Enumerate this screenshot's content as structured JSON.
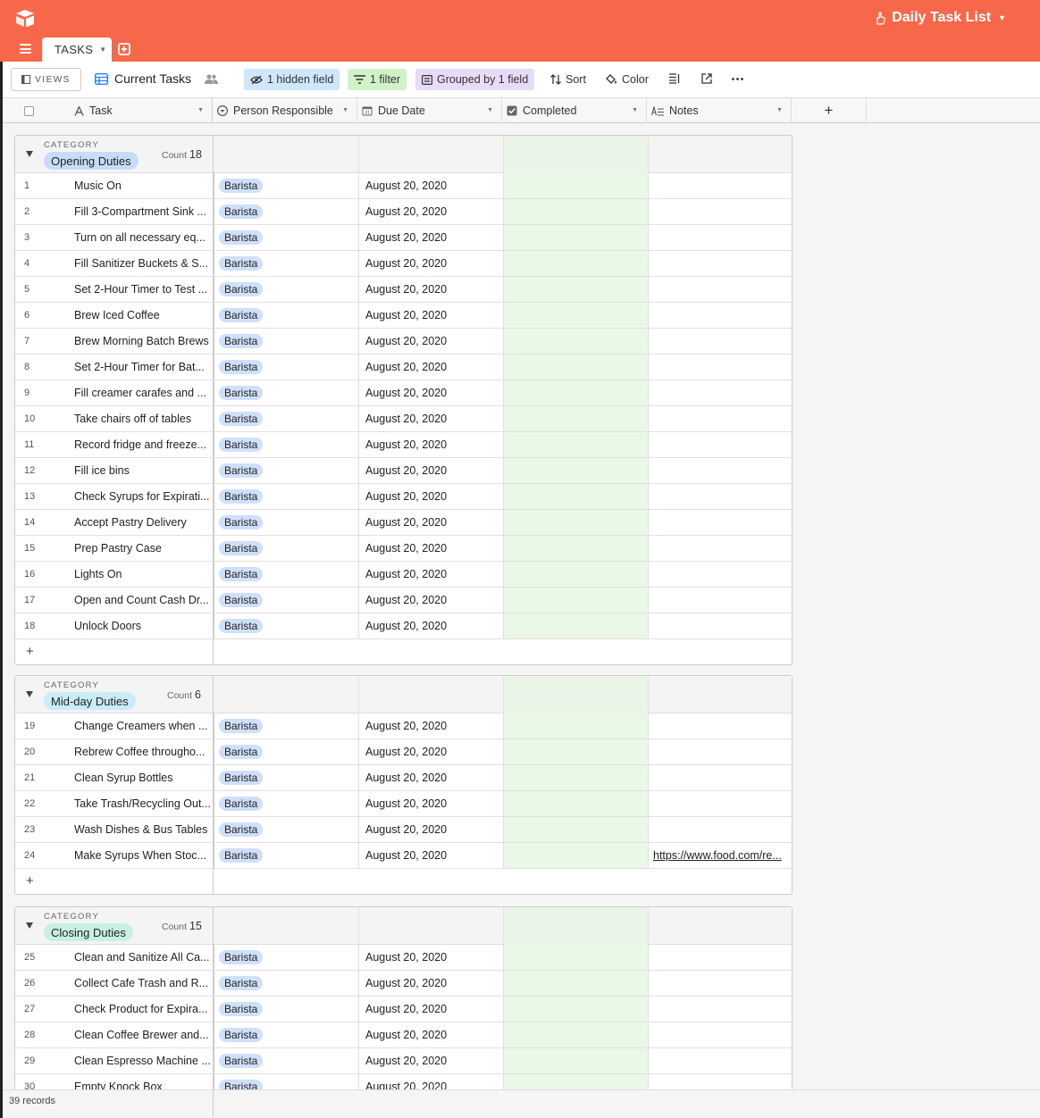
{
  "app": {
    "base_title": "Daily Task List",
    "tab_label": "TASKS",
    "colors": {
      "header": "#f7684a",
      "completed_col": "#eaf8e7"
    }
  },
  "toolbar": {
    "views_label": "VIEWS",
    "view_name": "Current Tasks",
    "hidden_field": "1 hidden field",
    "filter": "1 filter",
    "grouped": "Grouped by 1 field",
    "sort": "Sort",
    "color": "Color"
  },
  "columns": {
    "task": "Task",
    "person": "Person Responsible",
    "due": "Due Date",
    "completed": "Completed",
    "notes": "Notes"
  },
  "group_label": "CATEGORY",
  "count_label": "Count",
  "groups": [
    {
      "name": "Opening Duties",
      "count": "18",
      "chip_color": "#c6dcf9",
      "rows": [
        {
          "num": "1",
          "task": "Music On",
          "person": "Barista",
          "date": "August 20, 2020",
          "notes": ""
        },
        {
          "num": "2",
          "task": "Fill 3-Compartment Sink ...",
          "person": "Barista",
          "date": "August 20, 2020",
          "notes": ""
        },
        {
          "num": "3",
          "task": "Turn on all necessary eq...",
          "person": "Barista",
          "date": "August 20, 2020",
          "notes": ""
        },
        {
          "num": "4",
          "task": "Fill Sanitizer Buckets & S...",
          "person": "Barista",
          "date": "August 20, 2020",
          "notes": ""
        },
        {
          "num": "5",
          "task": "Set 2-Hour Timer to Test ...",
          "person": "Barista",
          "date": "August 20, 2020",
          "notes": ""
        },
        {
          "num": "6",
          "task": "Brew Iced Coffee",
          "person": "Barista",
          "date": "August 20, 2020",
          "notes": ""
        },
        {
          "num": "7",
          "task": "Brew Morning Batch Brews",
          "person": "Barista",
          "date": "August 20, 2020",
          "notes": ""
        },
        {
          "num": "8",
          "task": "Set 2-Hour Timer for Bat...",
          "person": "Barista",
          "date": "August 20, 2020",
          "notes": ""
        },
        {
          "num": "9",
          "task": "Fill creamer carafes and ...",
          "person": "Barista",
          "date": "August 20, 2020",
          "notes": ""
        },
        {
          "num": "10",
          "task": "Take chairs off of tables",
          "person": "Barista",
          "date": "August 20, 2020",
          "notes": ""
        },
        {
          "num": "11",
          "task": "Record fridge and freeze...",
          "person": "Barista",
          "date": "August 20, 2020",
          "notes": ""
        },
        {
          "num": "12",
          "task": "Fill ice bins",
          "person": "Barista",
          "date": "August 20, 2020",
          "notes": ""
        },
        {
          "num": "13",
          "task": "Check Syrups for Expirati...",
          "person": "Barista",
          "date": "August 20, 2020",
          "notes": ""
        },
        {
          "num": "14",
          "task": "Accept Pastry Delivery",
          "person": "Barista",
          "date": "August 20, 2020",
          "notes": ""
        },
        {
          "num": "15",
          "task": "Prep Pastry Case",
          "person": "Barista",
          "date": "August 20, 2020",
          "notes": ""
        },
        {
          "num": "16",
          "task": "Lights On",
          "person": "Barista",
          "date": "August 20, 2020",
          "notes": ""
        },
        {
          "num": "17",
          "task": "Open and Count Cash Dr...",
          "person": "Barista",
          "date": "August 20, 2020",
          "notes": ""
        },
        {
          "num": "18",
          "task": "Unlock Doors",
          "person": "Barista",
          "date": "August 20, 2020",
          "notes": ""
        }
      ]
    },
    {
      "name": "Mid-day Duties",
      "count": "6",
      "chip_color": "#c9ecf7",
      "rows": [
        {
          "num": "19",
          "task": "Change Creamers when ...",
          "person": "Barista",
          "date": "August 20, 2020",
          "notes": ""
        },
        {
          "num": "20",
          "task": "Rebrew Coffee througho...",
          "person": "Barista",
          "date": "August 20, 2020",
          "notes": ""
        },
        {
          "num": "21",
          "task": "Clean Syrup Bottles",
          "person": "Barista",
          "date": "August 20, 2020",
          "notes": ""
        },
        {
          "num": "22",
          "task": "Take Trash/Recycling Out...",
          "person": "Barista",
          "date": "August 20, 2020",
          "notes": ""
        },
        {
          "num": "23",
          "task": "Wash Dishes & Bus Tables",
          "person": "Barista",
          "date": "August 20, 2020",
          "notes": ""
        },
        {
          "num": "24",
          "task": "Make Syrups When Stoc...",
          "person": "Barista",
          "date": "August 20, 2020",
          "notes": "https://www.food.com/re..."
        }
      ]
    },
    {
      "name": "Closing Duties",
      "count": "15",
      "chip_color": "#c8f1e2",
      "rows": [
        {
          "num": "25",
          "task": "Clean and Sanitize All Ca...",
          "person": "Barista",
          "date": "August 20, 2020",
          "notes": ""
        },
        {
          "num": "26",
          "task": "Collect Cafe Trash and R...",
          "person": "Barista",
          "date": "August 20, 2020",
          "notes": ""
        },
        {
          "num": "27",
          "task": "Check Product for Expira...",
          "person": "Barista",
          "date": "August 20, 2020",
          "notes": ""
        },
        {
          "num": "28",
          "task": "Clean Coffee Brewer and...",
          "person": "Barista",
          "date": "August 20, 2020",
          "notes": ""
        },
        {
          "num": "29",
          "task": "Clean Espresso Machine ...",
          "person": "Barista",
          "date": "August 20, 2020",
          "notes": ""
        },
        {
          "num": "30",
          "task": "Empty Knock Box",
          "person": "Barista",
          "date": "August 20, 2020",
          "notes": ""
        }
      ]
    }
  ],
  "footer": {
    "records": "39 records"
  }
}
